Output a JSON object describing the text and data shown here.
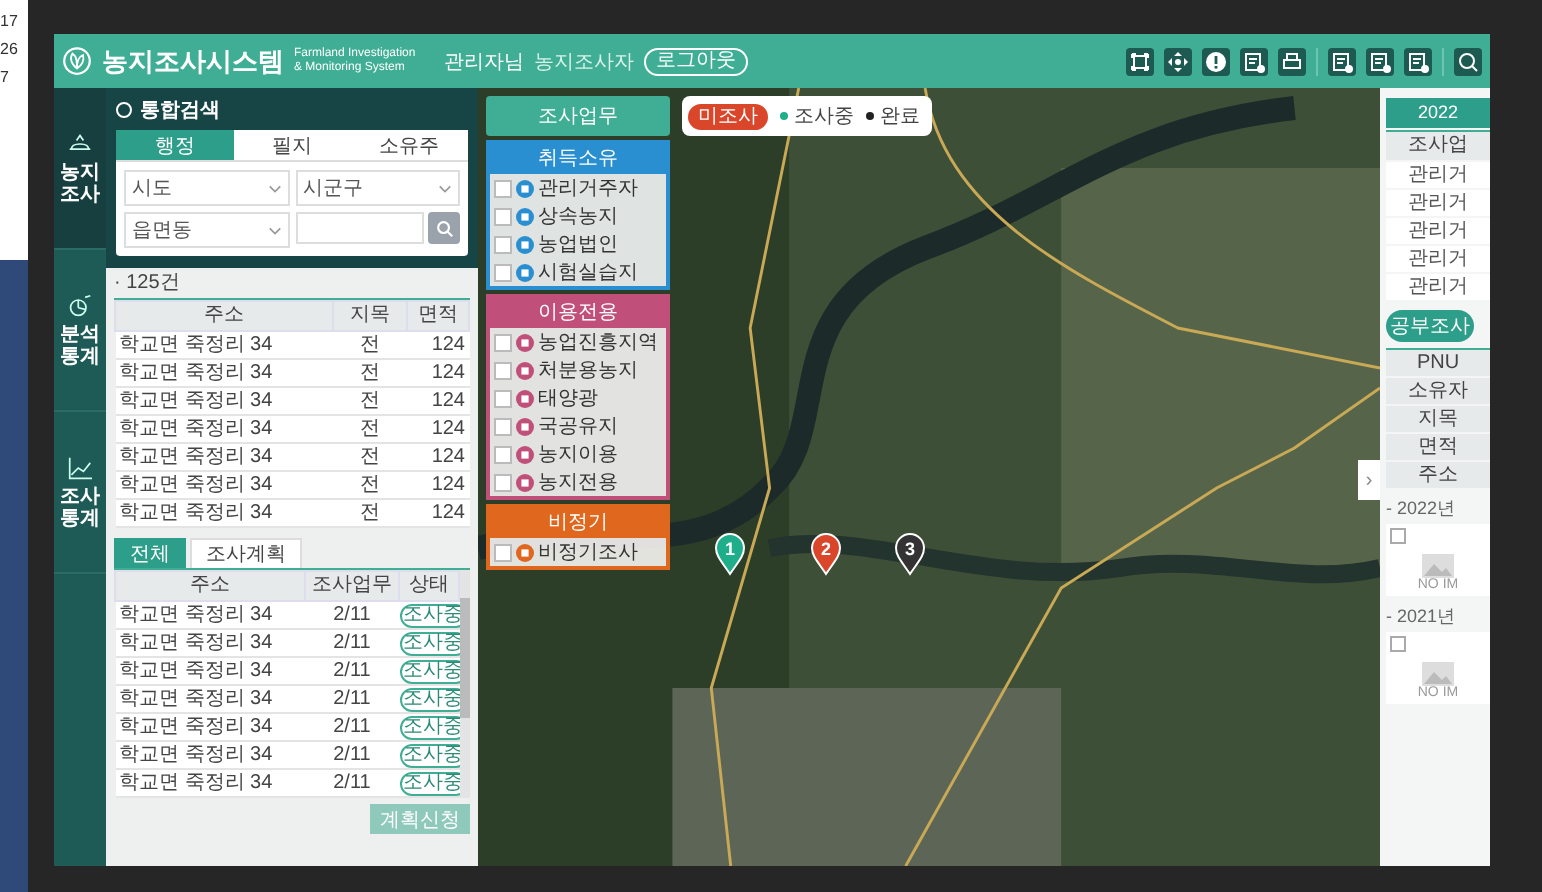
{
  "background_strip": [
    "17",
    "26",
    "7"
  ],
  "header": {
    "title": "농지조사시스템",
    "subtitle": "Farmland Investigation & Monitoring System",
    "user": "관리자님",
    "role": "농지조사자",
    "logout": "로그아웃"
  },
  "sidebar": {
    "items": [
      {
        "label": "농지 조사",
        "selected": true
      },
      {
        "label": "분석 통계",
        "selected": false
      },
      {
        "label": "조사 통계",
        "selected": false
      }
    ]
  },
  "search": {
    "title": "통합검색",
    "tabs": [
      {
        "label": "행정",
        "selected": true
      },
      {
        "label": "필지",
        "selected": false
      },
      {
        "label": "소유주",
        "selected": false
      }
    ],
    "selects": [
      "시도",
      "시군구",
      "읍면동"
    ],
    "count": "· 125건",
    "columns": [
      "주소",
      "지목",
      "면적"
    ],
    "rows": [
      [
        "학교면 죽정리 34",
        "전",
        "124"
      ],
      [
        "학교면 죽정리 34",
        "전",
        "124"
      ],
      [
        "학교면 죽정리 34",
        "전",
        "124"
      ],
      [
        "학교면 죽정리 34",
        "전",
        "124"
      ],
      [
        "학교면 죽정리 34",
        "전",
        "124"
      ],
      [
        "학교면 죽정리 34",
        "전",
        "124"
      ],
      [
        "학교면 죽정리 34",
        "전",
        "124"
      ]
    ]
  },
  "plan": {
    "tabs": [
      {
        "label": "전체",
        "selected": true
      },
      {
        "label": "조사계획",
        "selected": false
      }
    ],
    "columns": [
      "주소",
      "조사업무",
      "상태"
    ],
    "rows": [
      [
        "학교면 죽정리 34",
        "2/11",
        "조사중"
      ],
      [
        "학교면 죽정리 34",
        "2/11",
        "조사중"
      ],
      [
        "학교면 죽정리 34",
        "2/11",
        "조사중"
      ],
      [
        "학교면 죽정리 34",
        "2/11",
        "조사중"
      ],
      [
        "학교면 죽정리 34",
        "2/11",
        "조사중"
      ],
      [
        "학교면 죽정리 34",
        "2/11",
        "조사중"
      ],
      [
        "학교면 죽정리 34",
        "2/11",
        "조사중"
      ]
    ],
    "button": "계획신청"
  },
  "layers": {
    "button": "조사업무",
    "groups": [
      {
        "title": "취득소유",
        "color": "#2a8fd0",
        "items": [
          {
            "label": "관리거주자",
            "checked": false
          },
          {
            "label": "상속농지",
            "checked": false
          },
          {
            "label": "농업법인",
            "checked": false
          },
          {
            "label": "시험실습지",
            "checked": false
          }
        ]
      },
      {
        "title": "이용전용",
        "color": "#c0507a",
        "items": [
          {
            "label": "농업진흥지역",
            "checked": false
          },
          {
            "label": "처분용농지",
            "checked": false
          },
          {
            "label": "태양광",
            "checked": false
          },
          {
            "label": "국공유지",
            "checked": false
          },
          {
            "label": "농지이용",
            "checked": false
          },
          {
            "label": "농지전용",
            "checked": false
          }
        ]
      },
      {
        "title": "비정기",
        "color": "#e0671e",
        "items": [
          {
            "label": "비정기조사",
            "checked": false
          }
        ]
      }
    ]
  },
  "legend": [
    {
      "label": "미조사",
      "color": "#d9462a",
      "selected": true
    },
    {
      "label": "조사중",
      "color": "#1fae8a",
      "selected": false
    },
    {
      "label": "완료",
      "color": "#222222",
      "selected": false
    }
  ],
  "markers": [
    {
      "label": "1",
      "color": "#1fae8a"
    },
    {
      "label": "2",
      "color": "#d9462a"
    },
    {
      "label": "3",
      "color": "#333333"
    }
  ],
  "collapse": "›",
  "right_panel": {
    "year": "2022",
    "header": "조사업",
    "rows": [
      "관리거",
      "관리거",
      "관리거",
      "관리거",
      "관리거"
    ],
    "button": "공부조사",
    "fields": [
      "PNU",
      "소유자",
      "지목",
      "면적",
      "주소"
    ],
    "sections": [
      {
        "title": "- 2022년",
        "image_text": "NO IM",
        "checked": false
      },
      {
        "title": "- 2021년",
        "image_text": "NO IM",
        "checked": false
      }
    ]
  }
}
